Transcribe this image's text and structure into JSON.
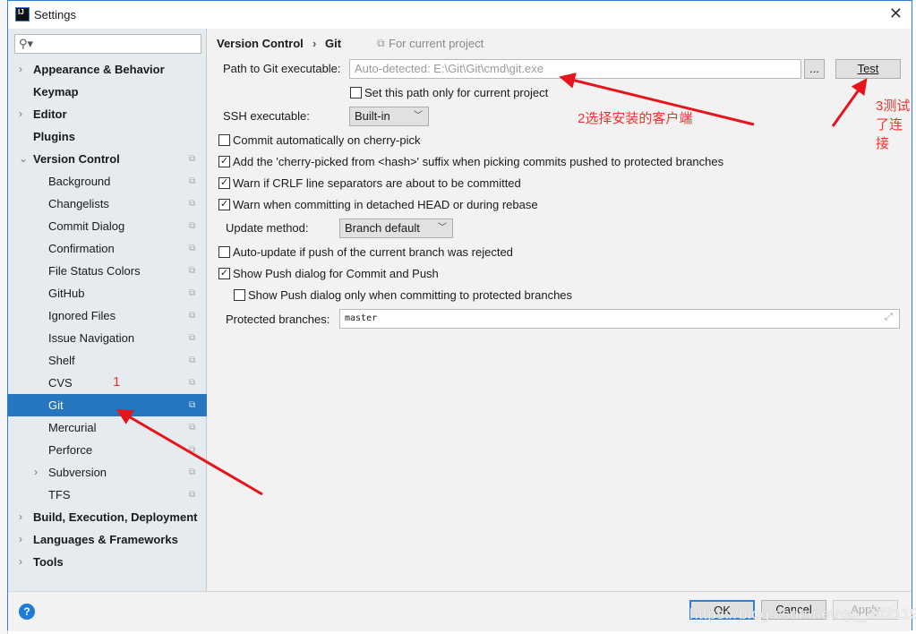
{
  "window": {
    "title": "Settings",
    "logo": "IJ",
    "close": "✕"
  },
  "sidebar": {
    "search_placeholder": "",
    "items": [
      {
        "label": "Appearance & Behavior",
        "bold": true,
        "arrow": "›"
      },
      {
        "label": "Keymap",
        "bold": true
      },
      {
        "label": "Editor",
        "bold": true,
        "arrow": "›"
      },
      {
        "label": "Plugins",
        "bold": true
      },
      {
        "label": "Version Control",
        "bold": true,
        "arrow": "⌄",
        "copy": true
      },
      {
        "label": "Background",
        "copy": true
      },
      {
        "label": "Changelists",
        "copy": true
      },
      {
        "label": "Commit Dialog",
        "copy": true
      },
      {
        "label": "Confirmation",
        "copy": true
      },
      {
        "label": "File Status Colors",
        "copy": true
      },
      {
        "label": "GitHub",
        "copy": true
      },
      {
        "label": "Ignored Files",
        "copy": true
      },
      {
        "label": "Issue Navigation",
        "copy": true
      },
      {
        "label": "Shelf",
        "copy": true
      },
      {
        "label": "CVS",
        "copy": true
      },
      {
        "label": "Git",
        "copy": true,
        "selected": true
      },
      {
        "label": "Mercurial",
        "copy": true
      },
      {
        "label": "Perforce",
        "copy": true
      },
      {
        "label": "Subversion",
        "copy": true,
        "arrow": "›"
      },
      {
        "label": "TFS",
        "copy": true
      },
      {
        "label": "Build, Execution, Deployment",
        "bold": true,
        "arrow": "›"
      },
      {
        "label": "Languages & Frameworks",
        "bold": true,
        "arrow": "›"
      },
      {
        "label": "Tools",
        "bold": true,
        "arrow": "›"
      }
    ]
  },
  "main": {
    "breadcrumb": [
      "Version Control",
      "Git"
    ],
    "breadcrumb_sep": "›",
    "scope": "For current project",
    "path_label": "Path to Git executable:",
    "path_placeholder": "Auto-detected: E:\\Git\\Git\\cmd\\git.exe",
    "browse": "...",
    "test": "Test",
    "set_path_only": {
      "label": "Set this path only for current project",
      "checked": false
    },
    "ssh_label": "SSH executable:",
    "ssh_value": "Built-in",
    "options": [
      {
        "label": "Commit automatically on cherry-pick",
        "checked": false
      },
      {
        "label": "Add the 'cherry-picked from <hash>' suffix when picking commits pushed to protected branches",
        "checked": true
      },
      {
        "label": "Warn if CRLF line separators are about to be committed",
        "checked": true
      },
      {
        "label": "Warn when committing in detached HEAD or during rebase",
        "checked": true
      }
    ],
    "update_label": "Update method:",
    "update_value": "Branch default",
    "options2": [
      {
        "label": "Auto-update if push of the current branch was rejected",
        "checked": false
      },
      {
        "label": "Show Push dialog for Commit and Push",
        "checked": true
      },
      {
        "label": "Show Push dialog only when committing to protected branches",
        "checked": false
      }
    ],
    "protected_label": "Protected branches:",
    "protected_value": "master"
  },
  "footer": {
    "ok": "OK",
    "cancel": "Cancel",
    "apply": "Apply",
    "help": "?"
  },
  "annotations": {
    "a1": "1",
    "a2": "2选择安装的客户端",
    "a3": [
      "3测试",
      "了连",
      "接"
    ],
    "color": "#f0322d"
  },
  "watermark": "https://blog.csdn.net/qq_30211955"
}
